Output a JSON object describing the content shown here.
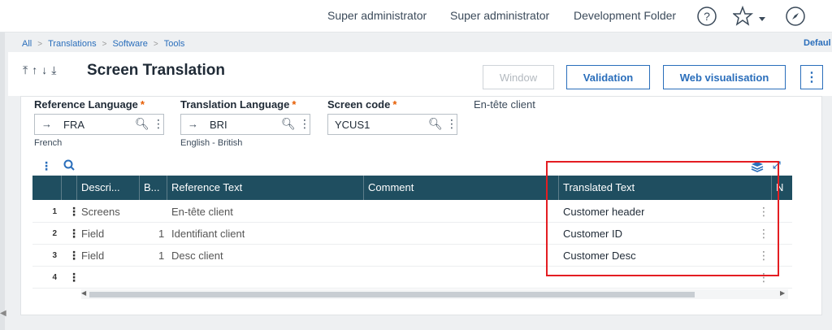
{
  "topbar": {
    "user1": "Super administrator",
    "user2": "Super administrator",
    "folder": "Development Folder"
  },
  "breadcrumb": [
    "All",
    "Translations",
    "Software",
    "Tools"
  ],
  "default_link": "Defaul",
  "header": {
    "title": "Screen Translation",
    "buttons": {
      "window": "Window",
      "validation": "Validation",
      "web": "Web visualisation"
    }
  },
  "fields": {
    "ref_lang": {
      "label": "Reference Language",
      "required": "*",
      "value": "FRA",
      "desc": "French"
    },
    "trans_lang": {
      "label": "Translation Language",
      "required": "*",
      "value": "BRI",
      "desc": "English - British"
    },
    "screen_code": {
      "label": "Screen code",
      "required": "*",
      "value": "YCUS1",
      "desc": "En-tête client"
    }
  },
  "grid": {
    "headers": [
      "Descri...",
      "B...",
      "Reference Text",
      "Comment",
      "Translated Text",
      "N"
    ],
    "rows": [
      {
        "num": "1",
        "desc": "Screens",
        "b": "",
        "ref": "En-tête client",
        "comment": "",
        "trans": "Customer header"
      },
      {
        "num": "2",
        "desc": "Field",
        "b": "1",
        "ref": "Identifiant client",
        "comment": "",
        "trans": "Customer ID"
      },
      {
        "num": "3",
        "desc": "Field",
        "b": "1",
        "ref": "Desc client",
        "comment": "",
        "trans": "Customer Desc"
      },
      {
        "num": "4",
        "desc": "",
        "b": "",
        "ref": "",
        "comment": "",
        "trans": ""
      }
    ]
  },
  "icons": [
    "help-icon",
    "star-icon",
    "compass-icon",
    "search-icon",
    "kebab-icon",
    "layers-icon",
    "expand-icon",
    "arrow-right-icon"
  ],
  "colors": {
    "accent": "#2a6ebb",
    "grid_header": "#1f4e60",
    "highlight": "#e41d22",
    "required": "#e65c00"
  }
}
